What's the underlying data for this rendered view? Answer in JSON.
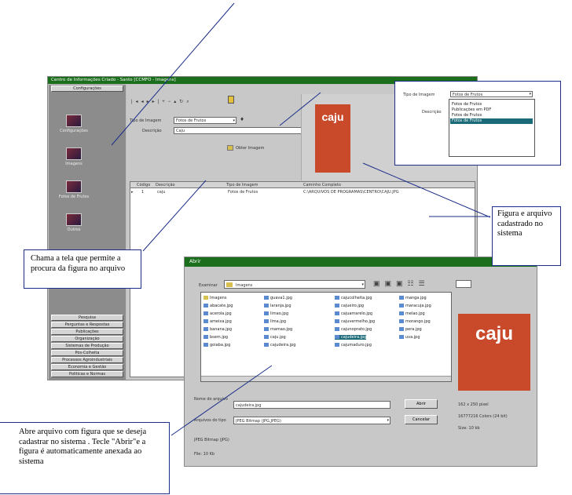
{
  "colors": {
    "titlebar": "#1b6e1b",
    "annotation_border": "#1a2e8a",
    "caju_red": "#c84a2a"
  },
  "main_window": {
    "title": "Centro de Informações Criado - Santo [CCMFO - Imagens]",
    "left_panel": {
      "tab_top": "Configurações",
      "icon_labels": [
        "Configurações",
        "Imagens",
        "Fotos de Frutos",
        "Outros"
      ],
      "menu_items": [
        "Pesquisa",
        "Perguntas e Respostas",
        "Publicações",
        "Organização",
        "Sistemas de Produção",
        "Pós-Colheita",
        "Processos Agroindustriais",
        "Economia e Gestão",
        "Políticas e Normas"
      ]
    },
    "form": {
      "tipo_label": "Tipo de Imagem",
      "tipo_value": "Fotos de Frutos",
      "descricao_label": "Descrição",
      "descricao_value": "Caju",
      "button_label": "Obter Imagem"
    },
    "preview_text": "caju",
    "grid": {
      "headers": [
        "Código",
        "Descrição",
        "Tipo de Imagem",
        "Caminho Completo"
      ],
      "rows": [
        [
          "1",
          "caju",
          "Fotos de Frutos",
          "C:\\ARQUIVOS DE PROGRAMAS\\CENTRO\\CAJU.JPG"
        ]
      ]
    }
  },
  "dropdown_zoom": {
    "tipo_label": "Tipo de Imagem",
    "value": "Fotos de Frutos",
    "descricao_label": "Descrição",
    "options": [
      "Fotos de Frutos",
      "Publicações em PDF",
      "Fotos de Frutos",
      "Fotos de Frutos"
    ],
    "selected_index": 3
  },
  "open_dialog": {
    "title": "Abrir",
    "lookin_label": "Examinar",
    "lookin_value": "Imagens",
    "files": [
      "Imagens",
      "abacate.jpg",
      "acerola.jpg",
      "ameixa.jpg",
      "banana.jpg",
      "bsem.jpg",
      "goiaba.jpg",
      "guava1.jpg",
      "laranja.jpg",
      "limao.jpg",
      "lima.jpg",
      "mamao.jpg",
      "caju.jpg",
      "cajudeira.jpg",
      "cajucolheita.jpg",
      "cajueiro.jpg",
      "cajuamarelo.jpg",
      "cajuvermelho.jpg",
      "cajunoprato.jpg",
      "caju2.jpg",
      "cajumaduro.jpg",
      "manga.jpg",
      "maracuja.jpg",
      "melao.jpg",
      "morango.jpg",
      "pera.jpg",
      "uva.jpg"
    ],
    "selected_file": "cajudeira.jpg",
    "filename_label": "Nome do arquivo",
    "filename_value": "cajudeira.jpg",
    "filetype_label": "Arquivos do tipo",
    "filetype_value": "JPEG Bitmap (JPG,JPEG)",
    "open_button": "Abrir",
    "cancel_button": "Cancelar",
    "info_line1": "JPEG Bitmap (JPG)",
    "info_line2": "File: 10 Kb",
    "preview_text": "caju",
    "props": [
      "162 x 250 pixel",
      "16777216 Colors (24 bit)",
      "Size: 10 kb"
    ]
  },
  "annotations": {
    "figura": "Figura e arquivo cadastrado no sistema",
    "chama": "Chama a tela  que permite a procura da figura no arquivo",
    "abre": "Abre arquivo com figura  que se deseja cadastrar no sistema . Tecle \"Abrir\"e a figura é automaticamente anexada ao sistema"
  }
}
